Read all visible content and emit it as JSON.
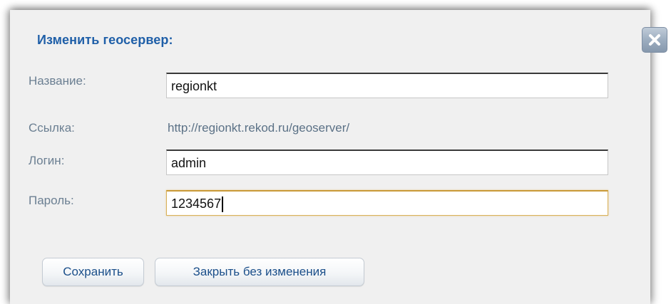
{
  "dialog": {
    "title": "Изменить геосервер:",
    "fields": {
      "name_label": "Название:",
      "name_value": "regionkt",
      "link_label": "Ссылка:",
      "link_value": "http://regionkt.rekod.ru/geoserver/",
      "login_label": "Логин:",
      "login_value": "admin",
      "password_label": "Пароль:",
      "password_value": "1234567"
    },
    "buttons": {
      "save": "Сохранить",
      "close_without_changes": "Закрыть без изменения"
    },
    "close_icon": "close-icon"
  },
  "colors": {
    "title": "#1f5fa8",
    "label": "#6b7f92",
    "button_text": "#1b4f8a",
    "dialog_bg": "#f0f0f0",
    "focus_border": "#d9b25a"
  }
}
